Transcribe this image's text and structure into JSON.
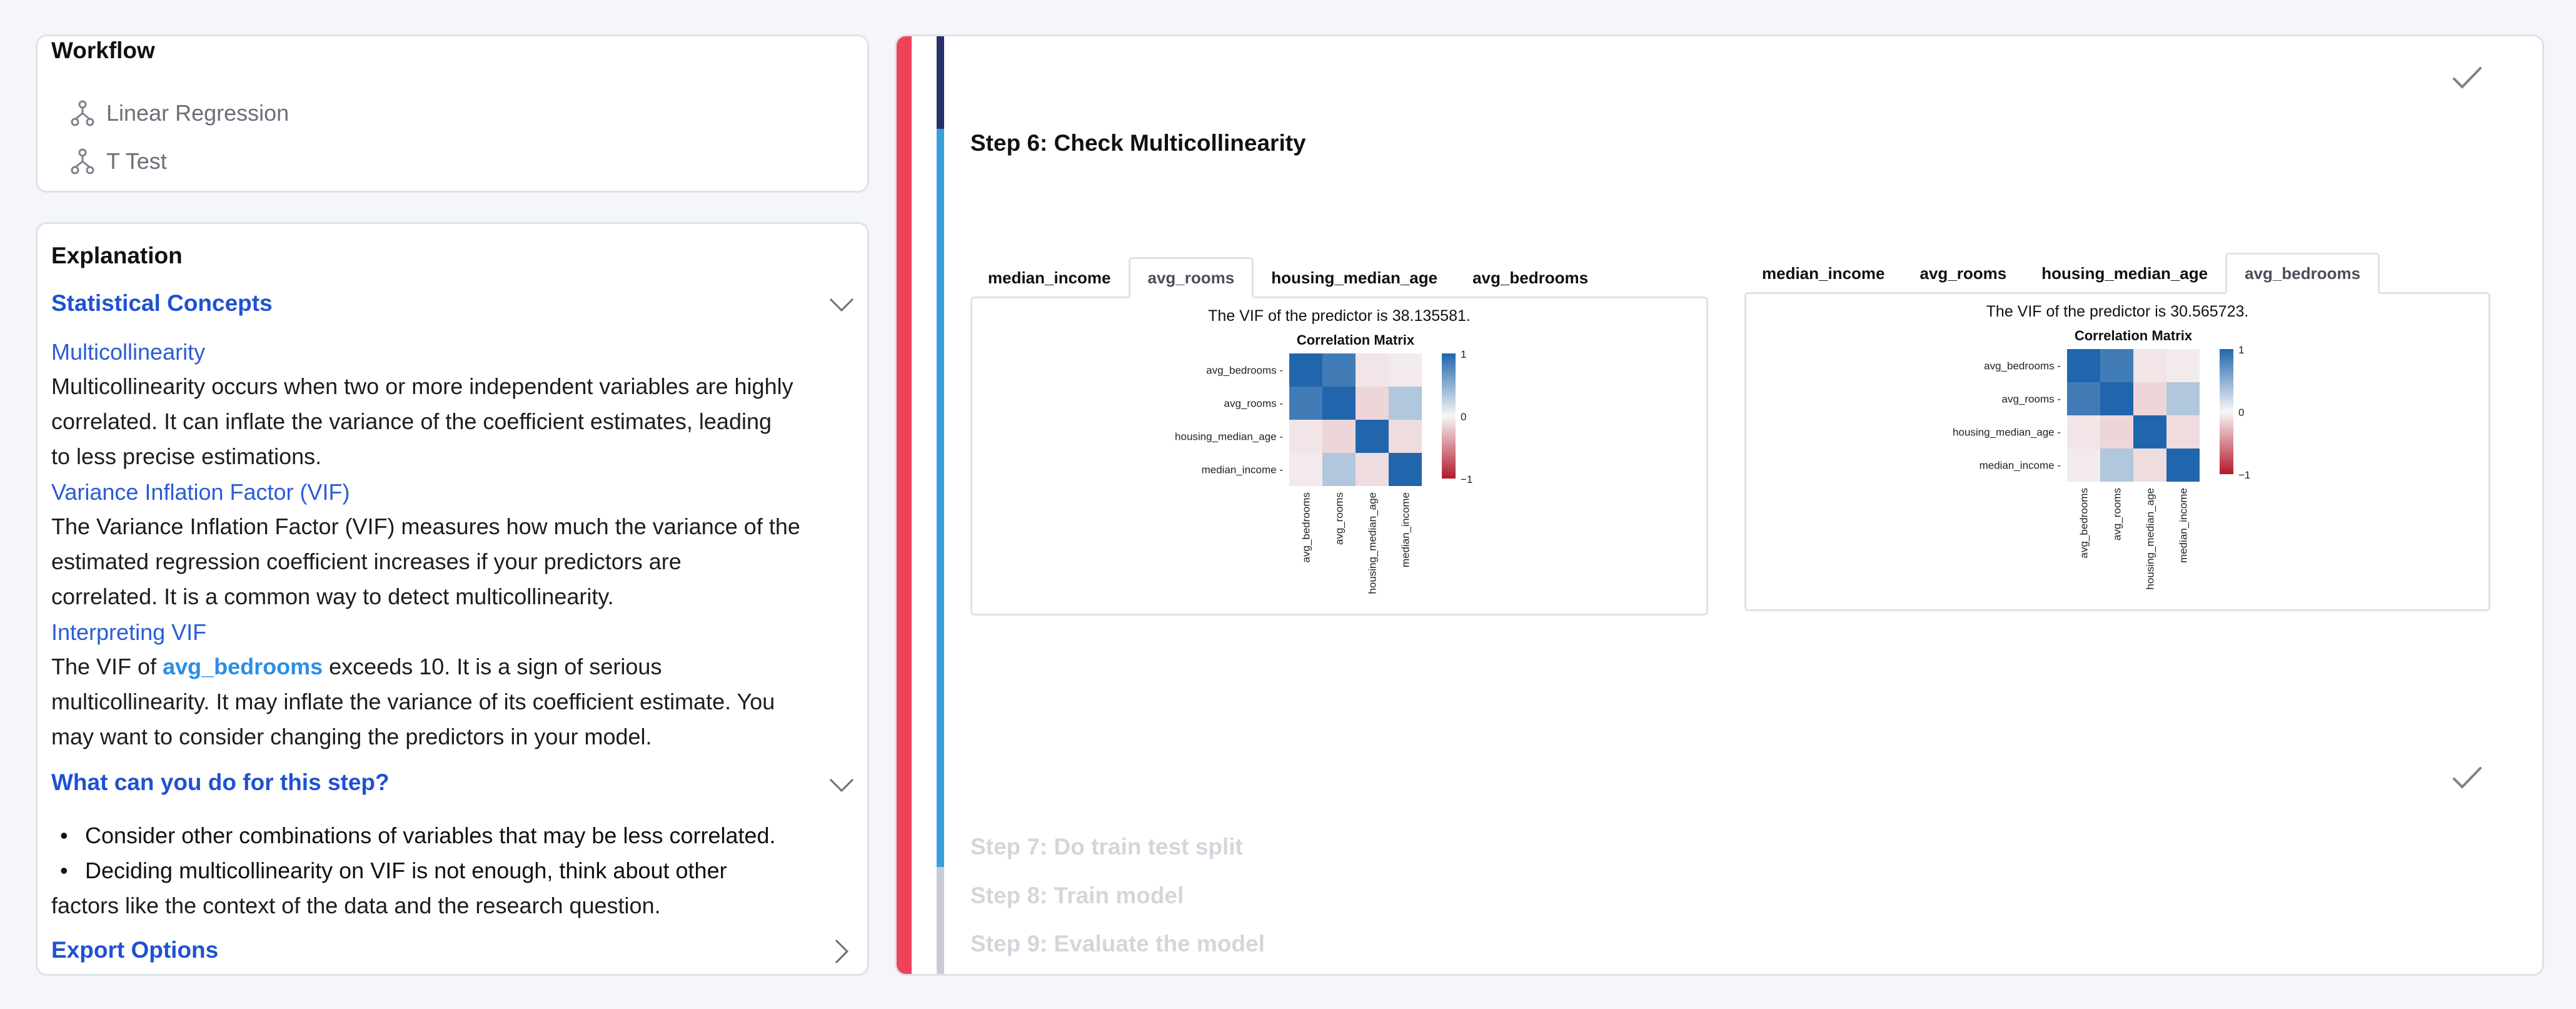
{
  "workflow": {
    "title": "Workflow",
    "items": [
      {
        "label": "Linear Regression",
        "icon": "workflow-branch-icon"
      },
      {
        "label": "T Test",
        "icon": "workflow-branch-icon"
      }
    ]
  },
  "explanation": {
    "title": "Explanation",
    "statistical_concepts": {
      "heading": "Statistical Concepts",
      "concepts": [
        {
          "name": "Multicollinearity",
          "lines": [
            "Multicollinearity occurs when two or more independent variables are highly",
            "correlated. It can inflate the variance of the coefficient estimates, leading",
            "to less precise estimations."
          ]
        },
        {
          "name": "Variance Inflation Factor (VIF)",
          "lines": [
            "The Variance Inflation Factor (VIF) measures how much the variance of the",
            "estimated regression coefficient increases if your predictors are",
            "correlated. It is a common way to detect multicollinearity."
          ]
        },
        {
          "name": "Interpreting VIF",
          "prefix": "The VIF of ",
          "highlight": "avg_bedrooms",
          "suffix": " exceeds 10. It is a sign of serious",
          "lines": [
            "multicollinearity. It may inflate the variance of its coefficient estimate. You",
            "may want to consider changing the predictors in your model."
          ]
        }
      ]
    },
    "what_can_you_do": {
      "heading": "What can you do for this step?",
      "tips": [
        "Consider other combinations of variables that may be less correlated.",
        "Deciding multicollinearity on VIF is not enough, think about other"
      ],
      "tip_continuation": "factors like the context of the data and the research question."
    },
    "export_options": {
      "heading": "Export Options"
    }
  },
  "step": {
    "title": "Step 6: Check Multicollinearity",
    "panels": [
      {
        "tabs": [
          "median_income",
          "avg_rooms",
          "housing_median_age",
          "avg_bedrooms"
        ],
        "active_tab": "avg_rooms",
        "vif_text": "The VIF of the predictor is 38.135581.",
        "chart_title": "Correlation Matrix"
      },
      {
        "tabs": [
          "median_income",
          "avg_rooms",
          "housing_median_age",
          "avg_bedrooms"
        ],
        "active_tab": "avg_bedrooms",
        "vif_text": "The VIF of the predictor is 30.565723.",
        "chart_title": "Correlation Matrix"
      }
    ],
    "upcoming": [
      "Step 7: Do train test split",
      "Step 8: Train model",
      "Step 9: Evaluate the model"
    ]
  },
  "colors": {
    "accent_blue": "#1f52d1",
    "highlight_blue": "#2a8ee8",
    "progress_red": "#f0435a",
    "track_navy": "#27306b",
    "track_blue": "#3aa0dd",
    "track_gray": "#c9ccd2"
  },
  "chart_data": [
    {
      "type": "heatmap",
      "title": "Correlation Matrix",
      "rows": [
        "avg_bedrooms",
        "avg_rooms",
        "housing_median_age",
        "median_income"
      ],
      "cols": [
        "avg_bedrooms",
        "avg_rooms",
        "housing_median_age",
        "median_income"
      ],
      "values": [
        [
          1.0,
          0.85,
          -0.08,
          -0.06
        ],
        [
          0.85,
          1.0,
          -0.15,
          0.33
        ],
        [
          -0.08,
          -0.15,
          1.0,
          -0.12
        ],
        [
          -0.06,
          0.33,
          -0.12,
          1.0
        ]
      ],
      "colorbar": {
        "min": -1,
        "max": 1,
        "ticks": [
          "1",
          "0",
          "−1"
        ]
      }
    },
    {
      "type": "heatmap",
      "title": "Correlation Matrix",
      "rows": [
        "avg_bedrooms",
        "avg_rooms",
        "housing_median_age",
        "median_income"
      ],
      "cols": [
        "avg_bedrooms",
        "avg_rooms",
        "housing_median_age",
        "median_income"
      ],
      "values": [
        [
          1.0,
          0.85,
          -0.08,
          -0.06
        ],
        [
          0.85,
          1.0,
          -0.15,
          0.33
        ],
        [
          -0.08,
          -0.15,
          1.0,
          -0.12
        ],
        [
          -0.06,
          0.33,
          -0.12,
          1.0
        ]
      ],
      "colorbar": {
        "min": -1,
        "max": 1,
        "ticks": [
          "1",
          "0",
          "−1"
        ]
      }
    }
  ]
}
